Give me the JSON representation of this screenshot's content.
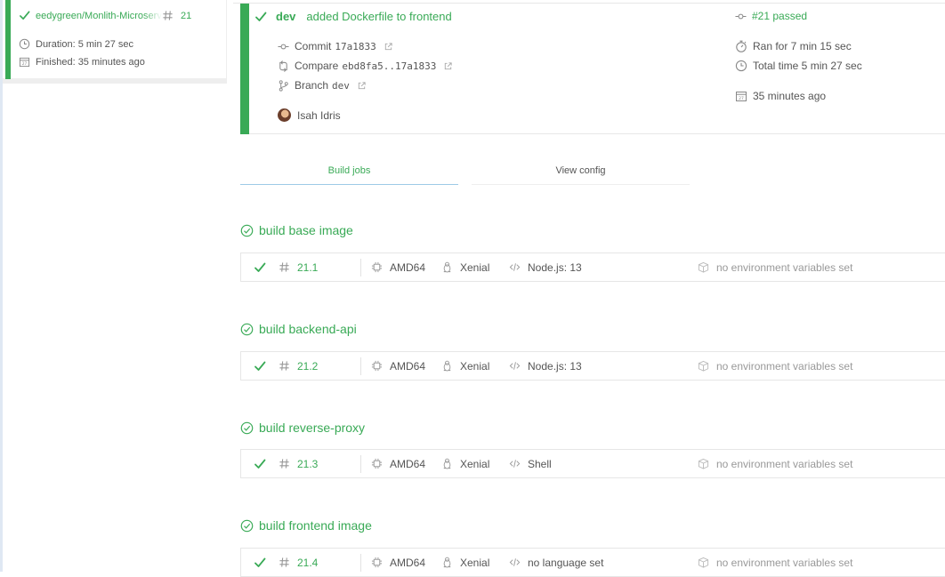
{
  "sidebar": {
    "repo": "eedygreen/Monlith-Microservices",
    "build_number": "21",
    "duration": "Duration: 5 min 27 sec",
    "finished": "Finished: 35 minutes ago"
  },
  "build": {
    "branch": "dev",
    "message": "added Dockerfile to frontend",
    "commit_label": "Commit",
    "commit_sha": "17a1833",
    "compare_label": "Compare",
    "compare_range": "ebd8fa5..17a1833",
    "branch_label": "Branch",
    "branch_name": "dev",
    "author": "Isah Idris",
    "status": "#21 passed",
    "ran_for": "Ran for 7 min 15 sec",
    "total_time": "Total time 5 min 27 sec",
    "finished_ago": "35 minutes ago"
  },
  "tabs": {
    "build_jobs": "Build jobs",
    "view_config": "View config"
  },
  "stages": [
    {
      "title": "build base image",
      "job": {
        "number": "21.1",
        "arch": "AMD64",
        "os": "Xenial",
        "language": "Node.js: 13",
        "env": "no environment variables set"
      }
    },
    {
      "title": "build backend-api",
      "job": {
        "number": "21.2",
        "arch": "AMD64",
        "os": "Xenial",
        "language": "Node.js: 13",
        "env": "no environment variables set"
      }
    },
    {
      "title": "build reverse-proxy",
      "job": {
        "number": "21.3",
        "arch": "AMD64",
        "os": "Xenial",
        "language": "Shell",
        "env": "no environment variables set"
      }
    },
    {
      "title": "build frontend image",
      "job": {
        "number": "21.4",
        "arch": "AMD64",
        "os": "Xenial",
        "language": "no language set",
        "env": "no environment variables set"
      }
    }
  ],
  "colors": {
    "passed": "#39aa56",
    "tab_active_underline": "#9ecae6",
    "muted_text": "#999999"
  }
}
